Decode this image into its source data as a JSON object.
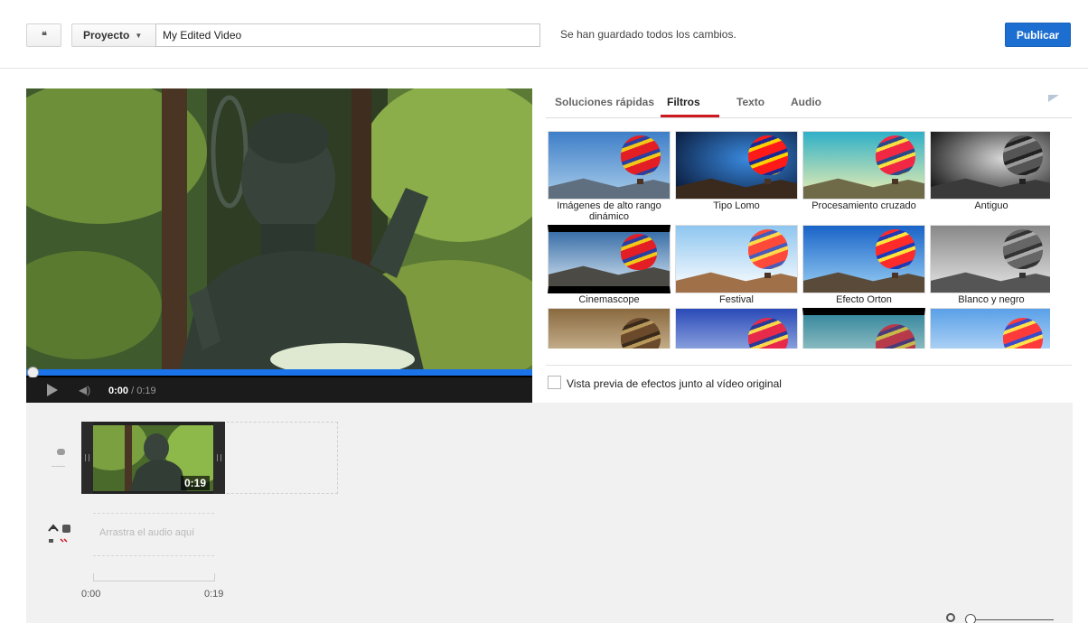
{
  "header": {
    "back_label": "❝",
    "project_label": "Proyecto",
    "title_value": "My Edited Video",
    "save_status": "Se han guardado todos los cambios.",
    "publish_label": "Publicar"
  },
  "player": {
    "current_time": "0:00",
    "duration": " / 0:19",
    "progress": 0
  },
  "tabs": [
    {
      "label": "Soluciones rápidas",
      "active": false
    },
    {
      "label": "Filtros",
      "active": true
    },
    {
      "label": "Texto",
      "active": false
    },
    {
      "label": "Audio",
      "active": false
    }
  ],
  "filters": [
    {
      "label": "Imágenes de alto rango dinámico"
    },
    {
      "label": "Tipo Lomo"
    },
    {
      "label": "Procesamiento cruzado"
    },
    {
      "label": "Antiguo"
    },
    {
      "label": "Cinemascope"
    },
    {
      "label": "Festival"
    },
    {
      "label": "Efecto Orton"
    },
    {
      "label": "Blanco y negro"
    }
  ],
  "preview": {
    "label": "Vista previa de efectos junto al vídeo original",
    "checked": false
  },
  "timeline": {
    "clip_duration": "0:19",
    "audio_drop_text": "Arrastra el audio aquí",
    "ruler_start": "0:00",
    "ruler_end": "0:19"
  },
  "colors": {
    "accent_blue": "#1c6fd1",
    "progress_blue": "#1a73e8",
    "tab_underline": "#cc181e"
  }
}
